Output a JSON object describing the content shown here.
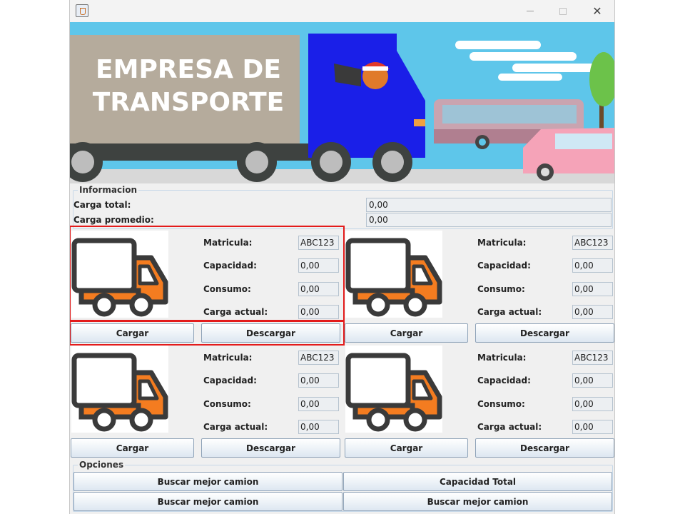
{
  "banner": {
    "line1": "EMPRESA DE",
    "line2": "TRANSPORTE"
  },
  "informacion": {
    "title": "Informacion",
    "carga_total_label": "Carga total:",
    "carga_total_value": "0,00",
    "carga_promedio_label": "Carga promedio:",
    "carga_promedio_value": "0,00"
  },
  "trucks": [
    {
      "matricula_label": "Matricula:",
      "matricula": "ABC123",
      "capacidad_label": "Capacidad:",
      "capacidad": "0,00",
      "consumo_label": "Consumo:",
      "consumo": "0,00",
      "carga_label": "Carga actual:",
      "carga": "0,00",
      "cargar": "Cargar",
      "descargar": "Descargar"
    },
    {
      "matricula_label": "Matricula:",
      "matricula": "ABC123",
      "capacidad_label": "Capacidad:",
      "capacidad": "0,00",
      "consumo_label": "Consumo:",
      "consumo": "0,00",
      "carga_label": "Carga actual:",
      "carga": "0,00",
      "cargar": "Cargar",
      "descargar": "Descargar"
    },
    {
      "matricula_label": "Matricula:",
      "matricula": "ABC123",
      "capacidad_label": "Capacidad:",
      "capacidad": "0,00",
      "consumo_label": "Consumo:",
      "consumo": "0,00",
      "carga_label": "Carga actual:",
      "carga": "0,00",
      "cargar": "Cargar",
      "descargar": "Descargar"
    },
    {
      "matricula_label": "Matricula:",
      "matricula": "ABC123",
      "capacidad_label": "Capacidad:",
      "capacidad": "0,00",
      "consumo_label": "Consumo:",
      "consumo": "0,00",
      "carga_label": "Carga actual:",
      "carga": "0,00",
      "cargar": "Cargar",
      "descargar": "Descargar"
    }
  ],
  "opciones": {
    "title": "Opciones",
    "btn1": "Buscar mejor camion",
    "btn2": "Capacidad Total",
    "btn3": "Buscar mejor camion",
    "btn4": "Buscar mejor camion"
  },
  "colors": {
    "truck_orange": "#f47c20",
    "truck_outline": "#3a3a3a",
    "sky": "#5ec6ea",
    "highlight": "#e31b1b"
  }
}
